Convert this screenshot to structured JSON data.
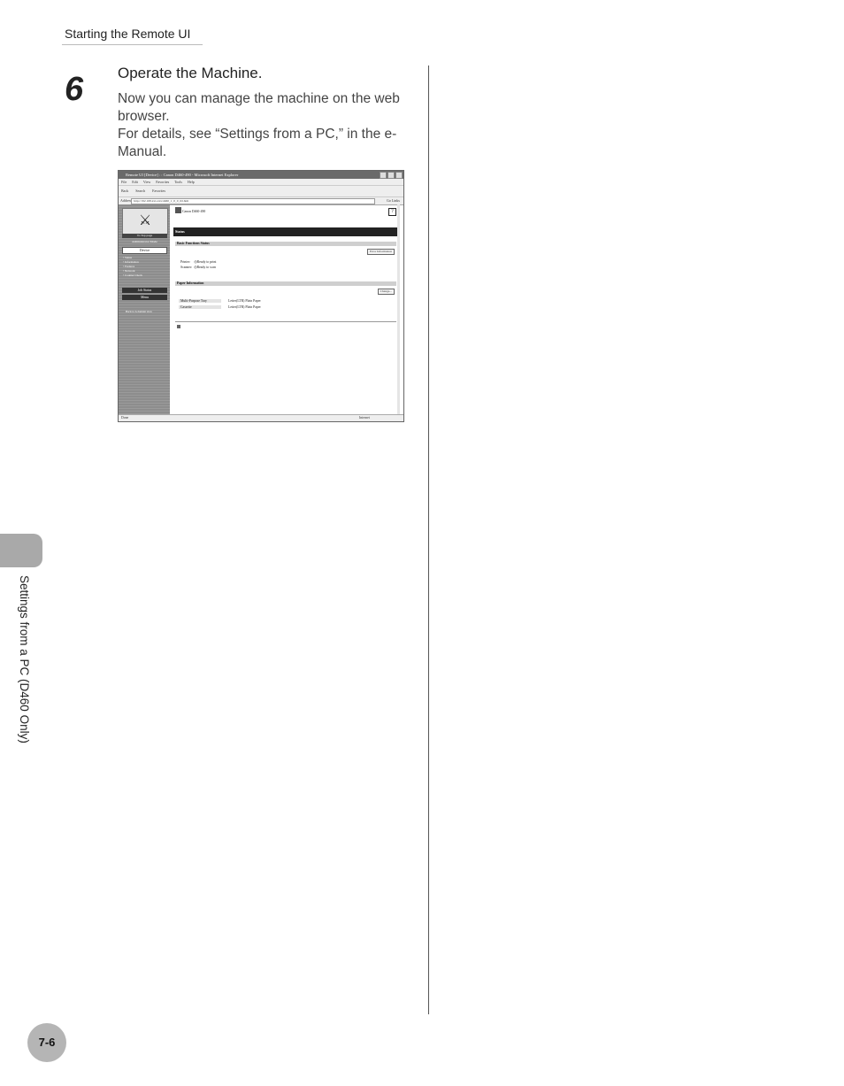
{
  "header": {
    "title": "Starting the Remote UI"
  },
  "step": {
    "number": "6",
    "title": "Operate the Machine.",
    "body_line1": "Now you can manage the machine on the web browser.",
    "body_line2": "For details, see “Settings from a PC,” in the e-Manual."
  },
  "screenshot": {
    "window_title": "Remote UI [Device] : : Canon D460-490 - Microsoft Internet Explorer",
    "menus": [
      "File",
      "Edit",
      "View",
      "Favorites",
      "Tools",
      "Help"
    ],
    "toolbar": {
      "back": "Back",
      "search": "Search",
      "favorites": "Favorites"
    },
    "address": {
      "label": "Address",
      "url": "http://192.168.xxx.xxx/d460_1_0_0_tbl.htm",
      "go": "Go",
      "links": "Links"
    },
    "nav": {
      "top_page": "To Top page",
      "admin_mode": "Administrator Mode",
      "device": "Device",
      "links": [
        "Status",
        "Information",
        "Features",
        "Network",
        "Counter Check"
      ],
      "job_status": "Job Status",
      "menu": "Menu",
      "note": "Back to A domain view"
    },
    "device_name": "Canon D460-490",
    "status_heading": "Status",
    "basic_functions_heading": "Basic Functions Status",
    "error_info_button": "Error Information",
    "printer_label": "Printer:",
    "printer_value": "Ready to print",
    "scanner_label": "Scanner:",
    "scanner_value": "Ready to scan",
    "paper_heading": "Paper Information",
    "change_button": "Change...",
    "paper_rows": [
      {
        "source": "Multi-Purpose Tray",
        "paper": "Letter(LTR) Plain Paper"
      },
      {
        "source": "Cassette",
        "paper": "Letter(LTR) Plain Paper"
      }
    ],
    "status_done": "Done",
    "status_zone": "Internet"
  },
  "side_tab": {
    "label": "Settings from a PC (D460 Only)"
  },
  "page_number": "7-6"
}
